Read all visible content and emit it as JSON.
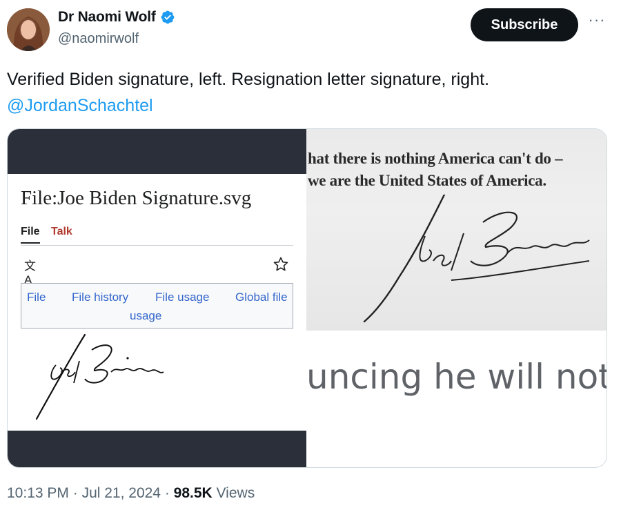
{
  "author": {
    "display_name": "Dr Naomi Wolf",
    "handle": "@naomirwolf",
    "verified_icon": "verified-badge-icon",
    "verified_color": "#1d9bf0"
  },
  "actions": {
    "subscribe_label": "Subscribe",
    "more_label": "···"
  },
  "tweet": {
    "text": "Verified Biden signature, left. Resignation letter signature, right.",
    "mention": "@JordanSchachtel"
  },
  "media": {
    "left": {
      "page_title": "File:Joe Biden Signature.svg",
      "tabs": [
        "File",
        "Talk"
      ],
      "translate_icon": "文A",
      "star_icon": "star-icon",
      "file_links": [
        "File",
        "File history",
        "File usage",
        "Global file",
        "usage"
      ]
    },
    "right": {
      "letter_line_1": "hat there is nothing America can't do – ",
      "letter_line_2": "we are the United States of America.",
      "caption_text": "uncing he will not s"
    }
  },
  "meta": {
    "time": "10:13 PM",
    "sep1": " · ",
    "date": "Jul 21, 2024",
    "sep2": " · ",
    "views_count": "98.5K",
    "views_label": " Views"
  },
  "colors": {
    "text": "#0f1419",
    "secondary": "#536471",
    "link": "#1d9bf0",
    "subscribe_bg": "#0f1419",
    "dark_band": "#2b2f3a"
  }
}
